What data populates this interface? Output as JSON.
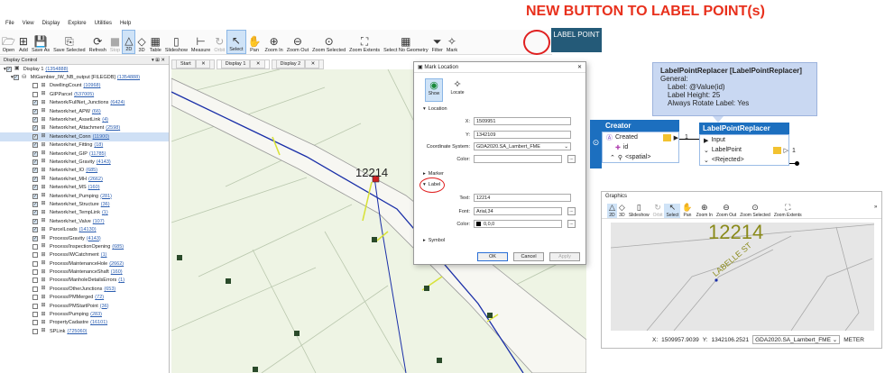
{
  "headline": "NEW BUTTON TO LABEL POINT(s)",
  "label_point_button": "LABEL POINT",
  "menu": [
    "File",
    "View",
    "Display",
    "Explore",
    "Utilities",
    "Help"
  ],
  "toolbar": [
    {
      "icon": "open-icon",
      "glyph": "🗁",
      "label": "Open",
      "state": "normal"
    },
    {
      "icon": "add-icon",
      "glyph": "⊞",
      "label": "Add",
      "state": "normal"
    },
    {
      "icon": "save-as-icon",
      "glyph": "💾",
      "label": "Save As",
      "state": "normal"
    },
    {
      "icon": "save-selected-icon",
      "glyph": "⎘",
      "label": "Save Selected",
      "state": "normal"
    },
    {
      "icon": "refresh-icon",
      "glyph": "⟳",
      "label": "Refresh",
      "state": "normal"
    },
    {
      "icon": "stop-icon",
      "glyph": "■",
      "label": "Stop",
      "state": "dim"
    },
    {
      "icon": "2d-icon",
      "glyph": "△",
      "label": "2D",
      "state": "active"
    },
    {
      "icon": "3d-icon",
      "glyph": "◇",
      "label": "3D",
      "state": "normal"
    },
    {
      "icon": "table-icon",
      "glyph": "▦",
      "label": "Table",
      "state": "normal"
    },
    {
      "icon": "slideshow-icon",
      "glyph": "▯",
      "label": "Slideshow",
      "state": "normal"
    },
    {
      "icon": "measure-icon",
      "glyph": "⊢",
      "label": "Measure",
      "state": "normal"
    },
    {
      "icon": "orbit-icon",
      "glyph": "↻",
      "label": "Orbit",
      "state": "dim"
    },
    {
      "icon": "select-icon",
      "glyph": "↖",
      "label": "Select",
      "state": "active"
    },
    {
      "icon": "pan-icon",
      "glyph": "✋",
      "label": "Pan",
      "state": "normal"
    },
    {
      "icon": "zoom-in-icon",
      "glyph": "⊕",
      "label": "Zoom In",
      "state": "normal"
    },
    {
      "icon": "zoom-out-icon",
      "glyph": "⊖",
      "label": "Zoom Out",
      "state": "normal"
    },
    {
      "icon": "zoom-selected-icon",
      "glyph": "⊙",
      "label": "Zoom Selected",
      "state": "normal"
    },
    {
      "icon": "zoom-extents-icon",
      "glyph": "⛶",
      "label": "Zoom Extents",
      "state": "normal"
    },
    {
      "icon": "select-no-geometry-icon",
      "glyph": "▦",
      "label": "Select No Geometry",
      "state": "normal"
    },
    {
      "icon": "filter-icon",
      "glyph": "⏷",
      "label": "Filter",
      "state": "normal"
    },
    {
      "icon": "mark-icon",
      "glyph": "✧",
      "label": "Mark",
      "state": "normal"
    }
  ],
  "display_control": {
    "title": "Display Control",
    "root": {
      "label": "Display 1",
      "count": "1354888"
    },
    "dataset": {
      "label": "MtGambier_IW_NB_output [FILEGDB]",
      "count": "1354888"
    },
    "layers": [
      {
        "name": "DwellingCount",
        "count": "10968",
        "checked": false
      },
      {
        "name": "GIPParcel",
        "count": "537005",
        "checked": false
      },
      {
        "name": "Network/FullNet_Junctions",
        "count": "6424",
        "checked": true
      },
      {
        "name": "Network/net_APW",
        "count": "66",
        "checked": true
      },
      {
        "name": "Network/net_AssetLink",
        "count": "4",
        "checked": true
      },
      {
        "name": "Network/net_Attachment",
        "count": "2598",
        "checked": true
      },
      {
        "name": "Network/net_Conn",
        "count": "11900",
        "checked": true,
        "selected": true
      },
      {
        "name": "Network/net_Fitting",
        "count": "18",
        "checked": true
      },
      {
        "name": "Network/net_GIP",
        "count": "11785",
        "checked": true
      },
      {
        "name": "Network/net_Gravity",
        "count": "4143",
        "checked": true
      },
      {
        "name": "Network/net_IO",
        "count": "685",
        "checked": true
      },
      {
        "name": "Network/net_MH",
        "count": "2662",
        "checked": true
      },
      {
        "name": "Network/net_MS",
        "count": "160",
        "checked": true
      },
      {
        "name": "Network/net_Pumping",
        "count": "281",
        "checked": true
      },
      {
        "name": "Network/net_Structure",
        "count": "36",
        "checked": true
      },
      {
        "name": "Network/net_TempLink",
        "count": "1",
        "checked": true
      },
      {
        "name": "Network/net_Valve",
        "count": "107",
        "checked": true
      },
      {
        "name": "ParcelLoads",
        "count": "14130",
        "checked": true
      },
      {
        "name": "Process/Gravity",
        "count": "4143",
        "checked": true
      },
      {
        "name": "Process/InspectionOpening",
        "count": "685",
        "checked": false
      },
      {
        "name": "Process/IWCatchment",
        "count": "1",
        "checked": false
      },
      {
        "name": "Process/MaintenanceHole",
        "count": "2662",
        "checked": false
      },
      {
        "name": "Process/MaintenanceShaft",
        "count": "160",
        "checked": false
      },
      {
        "name": "Process/ManholeDetailsErrors",
        "count": "1",
        "checked": false
      },
      {
        "name": "Process/OtherJunctions",
        "count": "653",
        "checked": false
      },
      {
        "name": "Process/PMMerged",
        "count": "72",
        "checked": false
      },
      {
        "name": "Process/PMStartPoint",
        "count": "36",
        "checked": false
      },
      {
        "name": "Process/Pumping",
        "count": "283",
        "checked": false
      },
      {
        "name": "PropertyCadastre",
        "count": "16101",
        "checked": false
      },
      {
        "name": "SPLink",
        "count": "725060",
        "checked": false
      }
    ]
  },
  "tabs": [
    "Start",
    "Display 1",
    "Display 2"
  ],
  "map_label": "12214",
  "dialog": {
    "title": "Mark Location",
    "show_label": "Show",
    "locate_label": "Locate",
    "location_section": "Location",
    "x_label": "X:",
    "x_value": "1509951",
    "y_label": "Y:",
    "y_value": "1342109",
    "cs_label": "Coordinate System:",
    "cs_value": "GDA2020.SA_Lambert_FME",
    "color_label": "Color:",
    "marker_section": "Marker",
    "label_section": "Label",
    "text_label": "Text:",
    "text_value": "12214",
    "font_label": "Font:",
    "font_value": "Arial,34",
    "label_color_label": "Color:",
    "label_color_value": "0,0,0",
    "symbol_section": "Symbol",
    "ok": "OK",
    "cancel": "Cancel",
    "apply": "Apply",
    "browse": "..."
  },
  "tooltip": {
    "title": "LabelPointReplacer [LabelPointReplacer]",
    "lines": [
      "General:",
      "Label: @Value(id)",
      "Label Height: 25",
      "Always Rotate Label: Yes"
    ]
  },
  "creator": {
    "title": "Creator",
    "created": "Created",
    "count": "1",
    "attr_id": "id",
    "attr_spatial": "<spatial>"
  },
  "replacer": {
    "title": "LabelPointReplacer",
    "input": "Input",
    "labelpoint": "LabelPoint",
    "labelpoint_count": "1",
    "rejected": "<Rejected>"
  },
  "graphics": {
    "title": "Graphics",
    "toolbar": [
      {
        "icon": "2d-icon",
        "glyph": "△",
        "label": "2D",
        "state": "active"
      },
      {
        "icon": "3d-icon",
        "glyph": "◇",
        "label": "3D",
        "state": "normal"
      },
      {
        "icon": "slideshow-icon",
        "glyph": "▯",
        "label": "Slideshow",
        "state": "normal"
      },
      {
        "icon": "orbit-icon",
        "glyph": "↻",
        "label": "Orbit",
        "state": "dim"
      },
      {
        "icon": "select-icon",
        "glyph": "↖",
        "label": "Select",
        "state": "active"
      },
      {
        "icon": "pan-icon",
        "glyph": "✋",
        "label": "Pan",
        "state": "normal"
      },
      {
        "icon": "zoom-in-icon",
        "glyph": "⊕",
        "label": "Zoom In",
        "state": "normal"
      },
      {
        "icon": "zoom-out-icon",
        "glyph": "⊖",
        "label": "Zoom Out",
        "state": "normal"
      },
      {
        "icon": "zoom-selected-icon",
        "glyph": "⊙",
        "label": "Zoom Selected",
        "state": "normal"
      },
      {
        "icon": "zoom-extents-icon",
        "glyph": "⛶",
        "label": "Zoom Extents",
        "state": "normal"
      }
    ],
    "label": "12214",
    "road_label": "LABELLE ST",
    "status_x_label": "X:",
    "status_x": "1509957.9039",
    "status_y_label": "Y:",
    "status_y": "1342106.2521",
    "status_cs": "GDA2020.SA_Lambert_FME",
    "status_units": "METER"
  },
  "colors": {
    "accent_red": "#e8301c",
    "fme_blue": "#1c6fbf",
    "button_navy": "#245a78",
    "tooltip_bg": "#c9d8f2",
    "label_olive": "#8a8a1a"
  }
}
